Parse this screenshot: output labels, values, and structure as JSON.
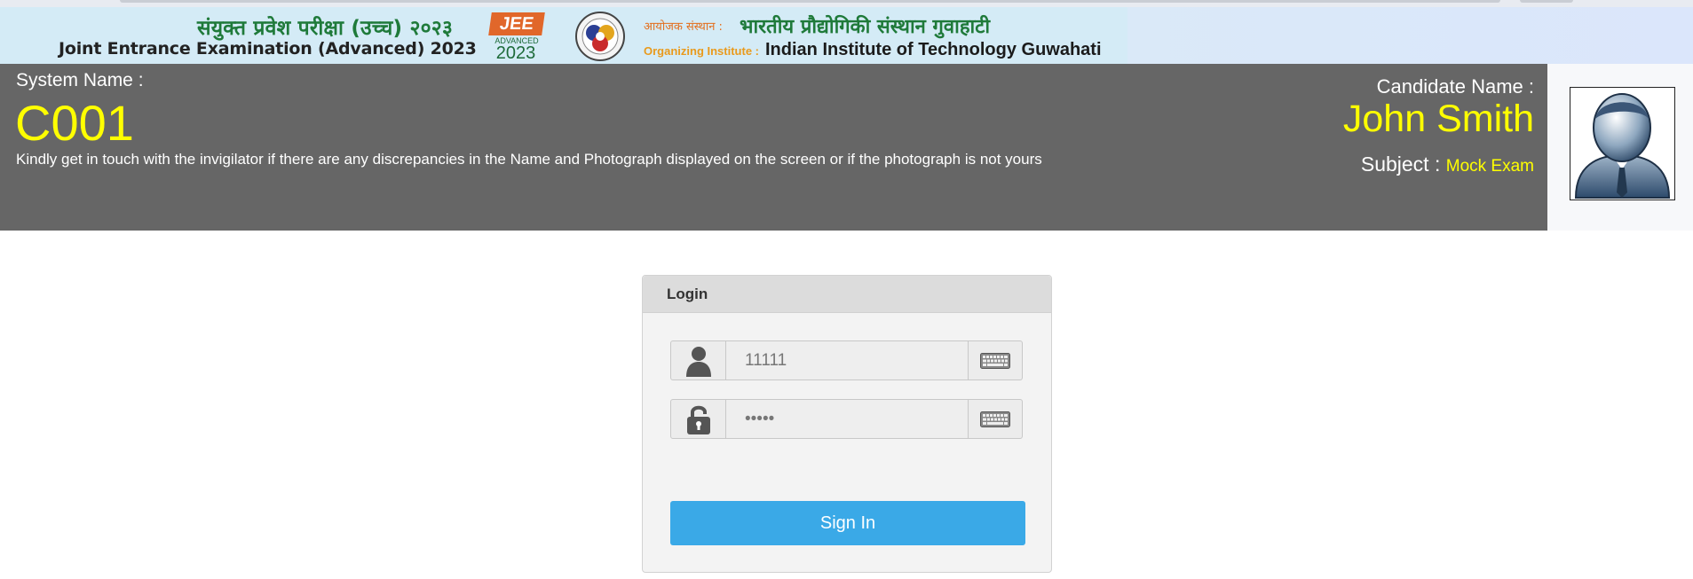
{
  "banner": {
    "hindi_title": "संयुक्त प्रवेश परीक्षा (उच्च) २०२३",
    "english_title": "Joint Entrance Examination (Advanced) 2023",
    "jee_logo_text": "JEE",
    "jee_logo_sub": "ADVANCED",
    "jee_logo_year": "2023",
    "org_hindi_label": "आयोजक संस्थान :",
    "org_hindi_name": "भारतीय प्रौद्योगिकी संस्थान गुवाहाटी",
    "org_english_label": "Organizing Institute :",
    "org_english_name": "Indian Institute of Technology Guwahati"
  },
  "header": {
    "system_name_label": "System Name :",
    "system_name_value": "C001",
    "notice": "Kindly get in touch with the invigilator if there are any discrepancies in the Name and Photograph displayed on the screen or if the photograph is not yours",
    "candidate_name_label": "Candidate Name :",
    "candidate_name_value": "John Smith",
    "subject_label": "Subject :",
    "subject_value": "Mock Exam",
    "photo_icon": "user-avatar-icon"
  },
  "login": {
    "title": "Login",
    "username_value": "11111",
    "password_value": "•••••",
    "username_icon": "user-icon",
    "password_icon": "lock-icon",
    "keyboard_icon": "keyboard-icon",
    "signin_label": "Sign In"
  },
  "colors": {
    "header_bg": "#666666",
    "highlight_yellow": "#ffff00",
    "signin_blue": "#3aa9e7",
    "banner_bg": "#d4ebf6"
  }
}
